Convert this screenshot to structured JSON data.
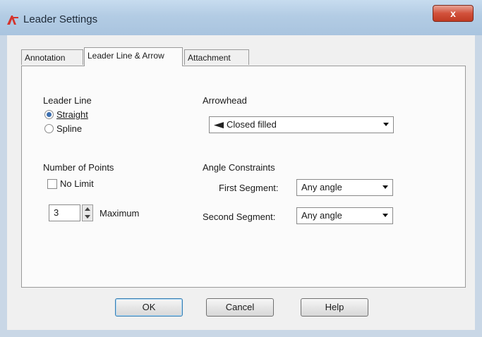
{
  "window": {
    "title": "Leader Settings",
    "close_glyph": "x"
  },
  "tabs": [
    {
      "label": "Annotation"
    },
    {
      "label": "Leader Line & Arrow"
    },
    {
      "label": "Attachment"
    }
  ],
  "leader_line": {
    "label": "Leader Line",
    "straight": "Straight",
    "spline": "Spline",
    "selected": "Straight"
  },
  "arrowhead": {
    "label": "Arrowhead",
    "value": "Closed filled"
  },
  "points": {
    "label": "Number of Points",
    "no_limit": "No Limit",
    "no_limit_checked": false,
    "value": "3",
    "max_label": "Maximum"
  },
  "angle": {
    "label": "Angle Constraints",
    "first_label": "First Segment:",
    "first_value": "Any angle",
    "second_label": "Second Segment:",
    "second_value": "Any angle"
  },
  "buttons": {
    "ok": "OK",
    "cancel": "Cancel",
    "help": "Help"
  }
}
